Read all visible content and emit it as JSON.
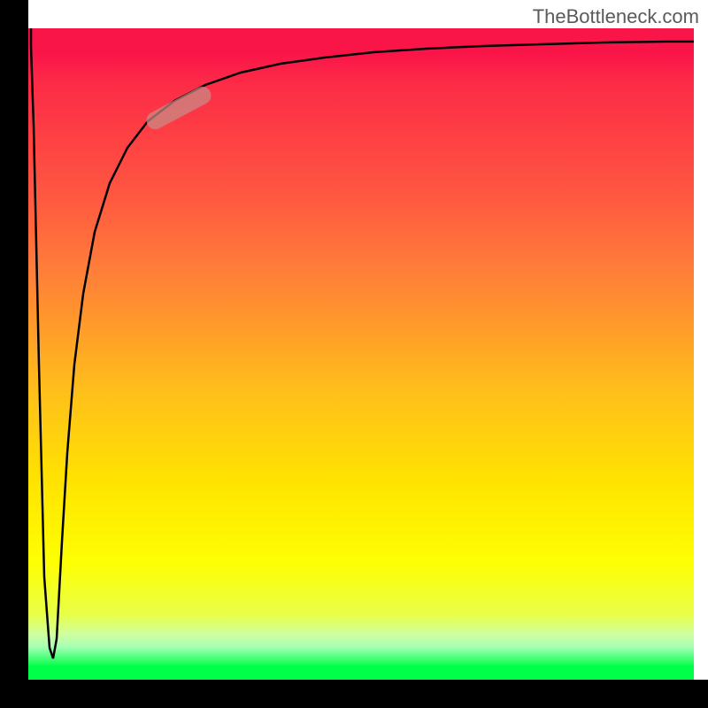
{
  "watermark": "TheBottleneck.com",
  "chart_data": {
    "type": "line",
    "title": "",
    "xlabel": "",
    "ylabel": "",
    "x": [
      0.0,
      0.02,
      0.04,
      0.045,
      0.05,
      0.06,
      0.08,
      0.1,
      0.12,
      0.15,
      0.18,
      0.22,
      0.26,
      0.3,
      0.35,
      0.4,
      0.45,
      0.5,
      0.55,
      0.6,
      0.65,
      0.7,
      0.75,
      0.8,
      0.85,
      0.9,
      0.95,
      1.0
    ],
    "y": [
      1.0,
      0.6,
      0.1,
      0.03,
      0.1,
      0.3,
      0.55,
      0.68,
      0.76,
      0.82,
      0.86,
      0.89,
      0.91,
      0.925,
      0.935,
      0.943,
      0.949,
      0.953,
      0.957,
      0.96,
      0.963,
      0.965,
      0.967,
      0.969,
      0.97,
      0.971,
      0.972,
      0.973
    ],
    "description": "Curve drops from top, dips to near-zero, then rises logarithmically and flattens near the top of the plot area",
    "xlim": [
      0,
      1
    ],
    "ylim": [
      0,
      1
    ],
    "highlight_region": {
      "x_range": [
        0.18,
        0.26
      ],
      "y_range": [
        0.85,
        0.91
      ]
    },
    "background_gradient": {
      "top": "#fa1549",
      "mid_upper": "#ff7a3b",
      "mid": "#ffe400",
      "mid_lower": "#feff03",
      "bottom": "#00ff49"
    }
  }
}
